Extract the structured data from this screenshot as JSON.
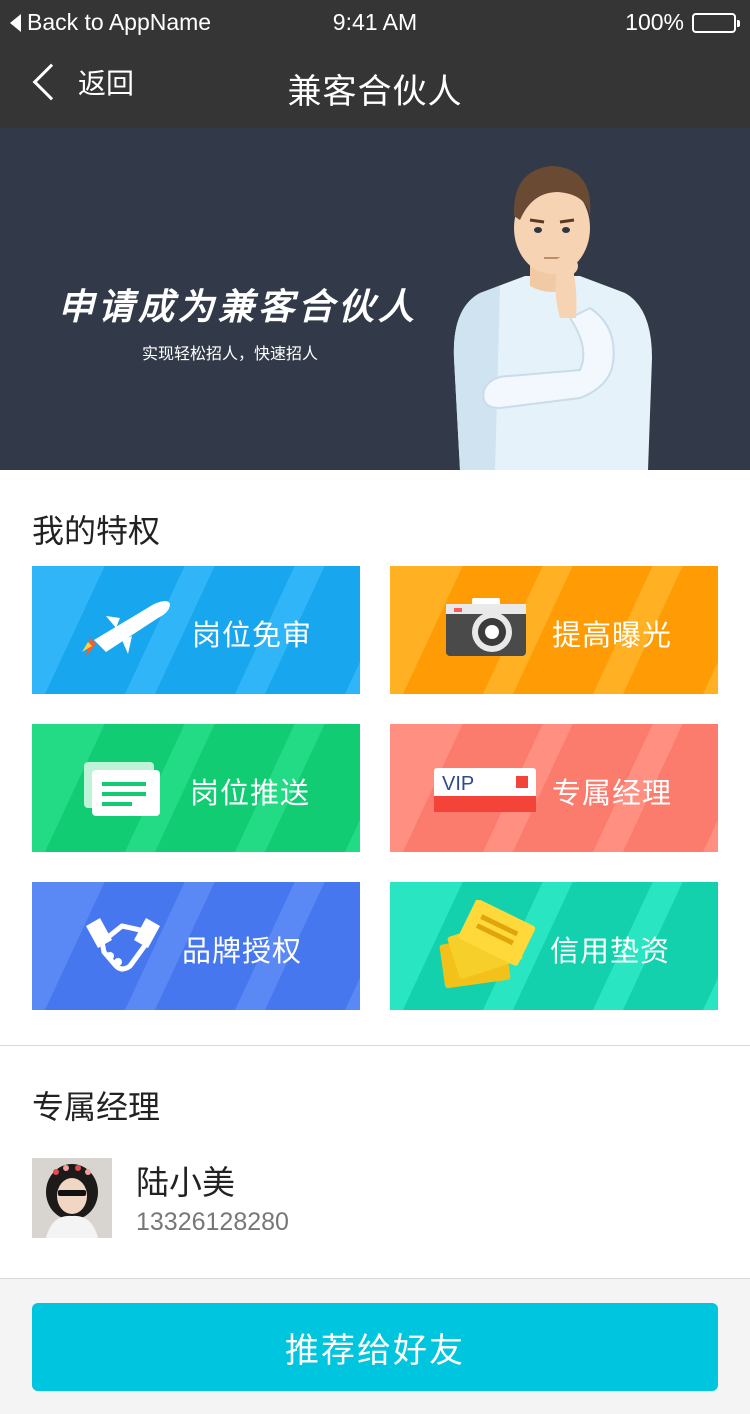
{
  "status_bar": {
    "back_app": "Back to AppName",
    "time": "9:41 AM",
    "battery": "100%"
  },
  "nav": {
    "back_label": "返回",
    "title": "兼客合伙人"
  },
  "banner": {
    "slogan": "申请成为兼客合伙人",
    "subtitle": "实现轻松招人，快速招人"
  },
  "privileges": {
    "title": "我的特权",
    "items": [
      {
        "label": "岗位免审",
        "icon": "rocket-icon",
        "color": "#30b6f8",
        "stripe": "#18a6ee"
      },
      {
        "label": "提高曝光",
        "icon": "camera-icon",
        "color": "#ffb023",
        "stripe": "#ff9c05"
      },
      {
        "label": "岗位推送",
        "icon": "message-icon",
        "color": "#23da85",
        "stripe": "#12cc74"
      },
      {
        "label": "专属经理",
        "icon": "vip-card-icon",
        "color": "#ff8f80",
        "stripe": "#fb7b6d"
      },
      {
        "label": "品牌授权",
        "icon": "handshake-icon",
        "color": "#5a88f4",
        "stripe": "#4777ee"
      },
      {
        "label": "信用垫资",
        "icon": "credit-cards-icon",
        "color": "#2ae5c2",
        "stripe": "#12d1ac"
      }
    ]
  },
  "manager": {
    "title": "专属经理",
    "name": "陆小美",
    "phone": "13326128280"
  },
  "cta": {
    "label": "推荐给好友"
  }
}
